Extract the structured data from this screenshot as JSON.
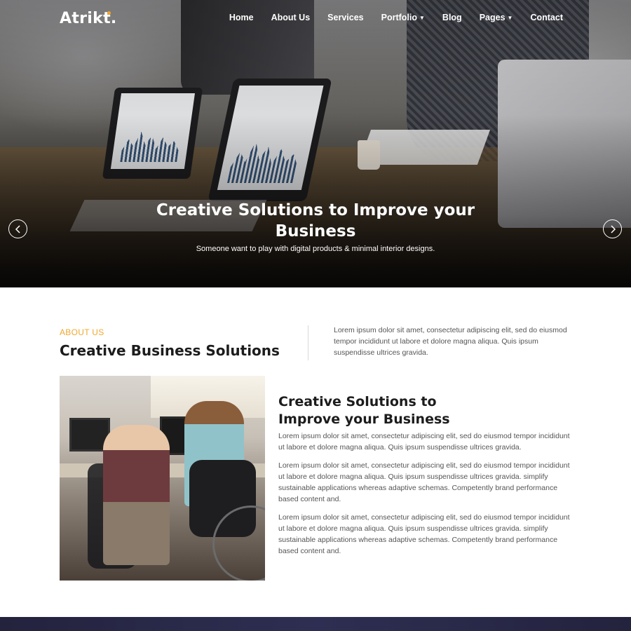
{
  "brand": {
    "logo_text": "Atrikt.",
    "accent_color": "#f5a623"
  },
  "nav": {
    "items": [
      {
        "label": "Home",
        "has_dropdown": false
      },
      {
        "label": "About Us",
        "has_dropdown": false
      },
      {
        "label": "Services",
        "has_dropdown": false
      },
      {
        "label": "Portfolio",
        "has_dropdown": true
      },
      {
        "label": "Blog",
        "has_dropdown": false
      },
      {
        "label": "Pages",
        "has_dropdown": true
      },
      {
        "label": "Contact",
        "has_dropdown": false
      }
    ]
  },
  "hero": {
    "title": "Creative Solutions to Improve your Business",
    "subtitle": "Someone want to play with digital products & minimal interior designs.",
    "prev_icon": "chevron-left-icon",
    "next_icon": "chevron-right-icon"
  },
  "about": {
    "label": "ABOUT US",
    "title": "Creative Business Solutions",
    "description": "Lorem ipsum dolor sit amet, consectetur adipiscing elit, sed do eiusmod tempor incididunt ut labore et dolore magna aliqua. Quis ipsum suspendisse ultrices gravida."
  },
  "feature": {
    "title": "Creative Solutions to Improve your Business",
    "paragraphs": [
      "Lorem ipsum dolor sit amet, consectetur adipiscing elit, sed do eiusmod tempor incididunt ut labore et dolore magna aliqua. Quis ipsum suspendisse ultrices gravida.",
      "Lorem ipsum dolor sit amet, consectetur adipiscing elit, sed do eiusmod tempor incididunt ut labore et dolore magna aliqua. Quis ipsum suspendisse ultrices gravida. simplify sustainable applications whereas adaptive schemas. Competently brand performance based content and.",
      "Lorem ipsum dolor sit amet, consectetur adipiscing elit, sed do eiusmod tempor incididunt ut labore et dolore magna aliqua. Quis ipsum suspendisse ultrices gravida. simplify sustainable applications whereas adaptive schemas. Competently brand performance based content and."
    ]
  }
}
